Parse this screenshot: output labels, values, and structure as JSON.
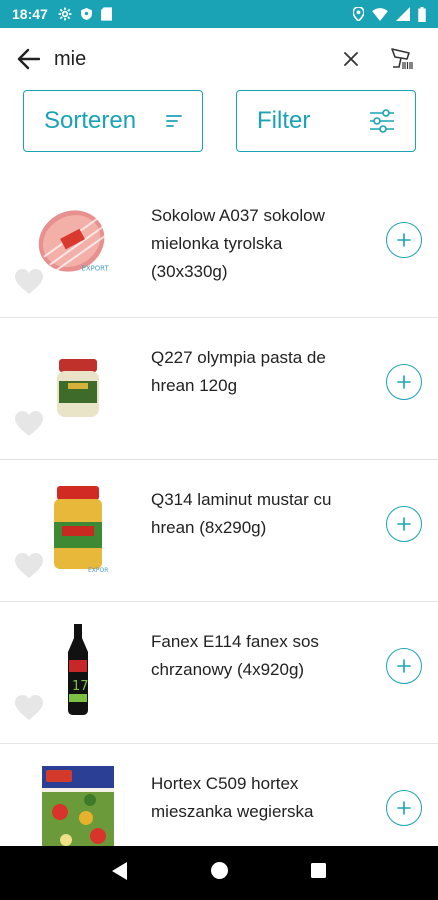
{
  "status": {
    "time": "18:47"
  },
  "search": {
    "value": "mie"
  },
  "toolbar": {
    "sort_label": "Sorteren",
    "filter_label": "Filter"
  },
  "products": [
    {
      "name": "Sokolow A037 sokolow mielonka tyrolska (30x330g)"
    },
    {
      "name": "Q227 olympia pasta de hrean 120g"
    },
    {
      "name": "Q314 laminut mustar cu hrean (8x290g)"
    },
    {
      "name": "Fanex E114 fanex sos chrzanowy (4x920g)"
    },
    {
      "name": "Hortex C509 hortex mieszanka wegierska"
    }
  ],
  "colors": {
    "accent": "#1aa3b5",
    "status_bar": "#1aa3b5",
    "nav_bar": "#000000"
  }
}
